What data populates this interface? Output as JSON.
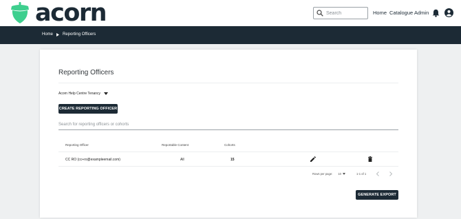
{
  "header": {
    "logo_text": "acorn",
    "search": {
      "placeholder": "Search"
    },
    "nav": [
      "Home",
      "Catalogue",
      "Admin"
    ],
    "icons": {
      "search": "search-icon",
      "notifications": "bell-icon",
      "account": "account-circle-icon"
    }
  },
  "breadcrumb": {
    "items": [
      "Home",
      "Reporting Officers"
    ]
  },
  "main": {
    "title": "Reporting Officers",
    "tenancy": "Acorn Help Centre Tenancy",
    "create_button": "CREATE REPORTING OFFICER",
    "filter_placeholder": "Search for reporting officers or cohorts",
    "table": {
      "columns": [
        "Reporting Officer",
        "Reportable Content",
        "Cohorts"
      ],
      "rows": [
        {
          "officer": "CC RO (cc+ro@exampleemail.com)",
          "content": "All",
          "cohorts": "15"
        }
      ],
      "row_icons": [
        "edit-icon",
        "delete-icon"
      ]
    },
    "pagination": {
      "rows_per_page_label": "Rows per page:",
      "rows_per_page": "10",
      "range": "1-1 of 1"
    },
    "export_button": "GENERATE EXPORT"
  },
  "colors": {
    "brand_green": "#3ecf8e",
    "dark": "#1c2a35",
    "page_bg": "#eef0f1"
  }
}
